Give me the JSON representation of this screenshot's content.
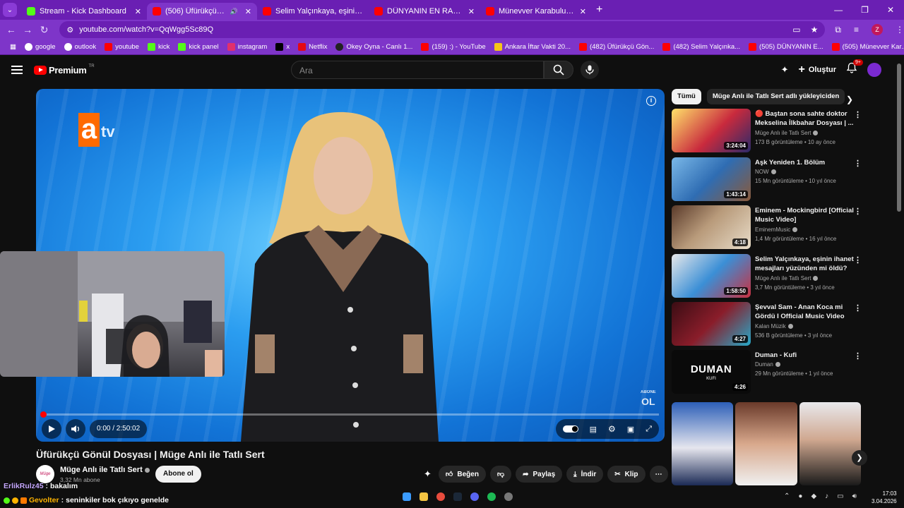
{
  "browser": {
    "tabs": [
      {
        "label": "Stream - Kick Dashboard",
        "icon": "kick-icon"
      },
      {
        "label": "(506) Üfürükçü Gönül Dosy",
        "icon": "youtube-icon"
      },
      {
        "label": "Selim Yalçınkaya, eşinin ihanet",
        "icon": "youtube-icon"
      },
      {
        "label": "DÜNYANIN EN RAHATSIZ EDİCİ",
        "icon": "youtube-icon"
      },
      {
        "label": "Münevver Karabulut Cinayetinin",
        "icon": "youtube-icon"
      }
    ],
    "url": "youtube.com/watch?v=QqWgg5Sc89Q",
    "bookmarks": [
      {
        "label": "google",
        "color": "#ffffff"
      },
      {
        "label": "outlook",
        "color": "#ffffff"
      },
      {
        "label": "youtube",
        "color": "#ff0000"
      },
      {
        "label": "kick",
        "color": "#53fc18"
      },
      {
        "label": "kick panel",
        "color": "#53fc18"
      },
      {
        "label": "instagram",
        "color": "#e1306c"
      },
      {
        "label": "x",
        "color": "#000000"
      },
      {
        "label": "Netflix",
        "color": "#e50914"
      },
      {
        "label": "Okey Oyna - Canlı 1...",
        "color": "#222222"
      },
      {
        "label": "(159) :) - YouTube",
        "color": "#ff0000"
      },
      {
        "label": "Ankara İftar Vakti 20...",
        "color": "#f5c518"
      },
      {
        "label": "(482) Üfürükçü Gön...",
        "color": "#ff0000"
      },
      {
        "label": "(482) Selim Yalçınka...",
        "color": "#ff0000"
      },
      {
        "label": "(505) DÜNYANIN E...",
        "color": "#ff0000"
      },
      {
        "label": "(505) Münevver Kar...",
        "color": "#ff0000"
      }
    ],
    "profile_letter": "Z"
  },
  "youtube": {
    "logo": "Premium",
    "logo_country": "TR",
    "search_placeholder": "Ara",
    "create_label": "Oluştur",
    "notif_badge": "9+"
  },
  "player": {
    "time": "0:00 / 2:50:02",
    "progress": 0.0,
    "channel_logo_a": "a",
    "channel_logo_tv": "tv",
    "watermark_top": "ABONE",
    "watermark_bottom": "OL"
  },
  "video": {
    "title": "Üfürükçü Gönül Dosyası | Müge Anlı ile Tatlı Sert",
    "channel": "Müge Anlı ile Tatlı Sert",
    "subscribers": "3,32 Mn abone",
    "subscribe_label": "Abone ol",
    "actions": {
      "like": "Beğen",
      "share": "Paylaş",
      "download": "İndir",
      "clip": "Klip"
    }
  },
  "chat": [
    {
      "user": "ErlikRulz45",
      "sep": " : ",
      "msg": "bakalım"
    },
    {
      "user": "Gevolter",
      "sep": " : ",
      "msg": "seninkiler bok çıkıyo genelde"
    }
  ],
  "sidebar": {
    "chips": [
      "Tümü",
      "Müge Anlı ile Tatlı Sert adlı yükleyiciden"
    ],
    "recs": [
      {
        "title": "🔴 Baştan sona sahte doktor Mekselina İlkbahar Dosyası | ...",
        "channel": "Müge Anlı ile Tatlı Sert",
        "meta": "173 B görüntüleme • 10 ay önce",
        "duration": "3:24:04",
        "thumb": "#c92a3d"
      },
      {
        "title": "Aşk Yeniden 1. Bölüm",
        "channel": "NOW",
        "meta": "15 Mn görüntüleme • 10 yıl önce",
        "duration": "1:43:14",
        "thumb": "#2f6db3"
      },
      {
        "title": "Eminem - Mockingbird [Official Music Video]",
        "channel": "EminemMusic",
        "meta": "1,4 Mr görüntüleme • 16 yıl önce",
        "duration": "4:18",
        "thumb": "#b89a7a"
      },
      {
        "title": "Selim Yalçınkaya, eşinin ihanet mesajları yüzünden mi öldü? ...",
        "channel": "Müge Anlı ile Tatlı Sert",
        "meta": "3,7 Mn görüntüleme • 3 yıl önce",
        "duration": "1:58:50",
        "thumb": "#3b8fd6"
      },
      {
        "title": "Şevval Sam - Anan Koca mi Gördü I Official Music Video ©...",
        "channel": "Kalan Müzik",
        "meta": "536 B görüntüleme • 3 yıl önce",
        "duration": "4:27",
        "thumb": "#8a1d2a"
      },
      {
        "title": "Duman - Kufi",
        "channel": "Duman",
        "meta": "29 Mn görüntüleme • 1 yıl önce",
        "duration": "4:26",
        "thumb": "#111111"
      }
    ],
    "duman_thumb_title": "DUMAN",
    "duman_thumb_sub": "KUFI"
  },
  "taskbar": {
    "time": "17:03",
    "date": "3.04.2026"
  }
}
